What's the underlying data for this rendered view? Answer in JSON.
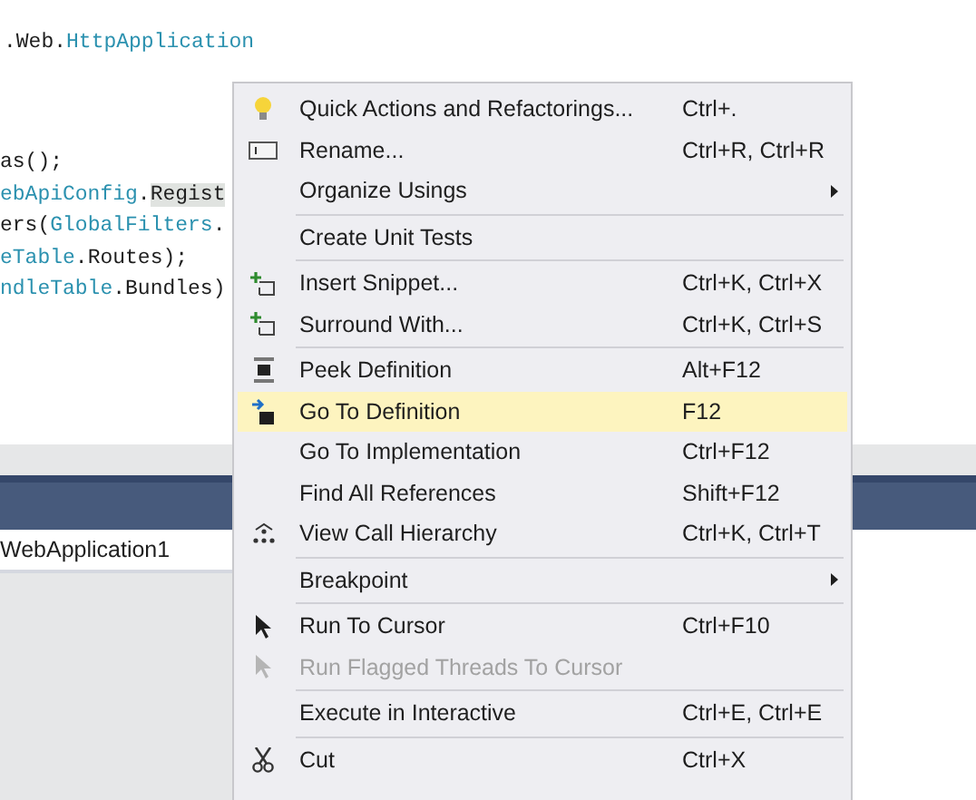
{
  "editor": {
    "lines": [
      [
        {
          "text": ".Web.",
          "kind": "plain"
        },
        {
          "text": "HttpApplication",
          "kind": "type"
        }
      ],
      [
        {
          "text": "as();",
          "kind": "plain"
        }
      ],
      [
        {
          "text": "ebApiConfig",
          "kind": "type"
        },
        {
          "text": ".",
          "kind": "plain"
        },
        {
          "text": "Regist",
          "kind": "highlight"
        }
      ],
      [
        {
          "text": "ers(",
          "kind": "plain"
        },
        {
          "text": "GlobalFilters",
          "kind": "type"
        },
        {
          "text": ".",
          "kind": "plain"
        }
      ],
      [
        {
          "text": "eTable",
          "kind": "type"
        },
        {
          "text": ".Routes);",
          "kind": "plain"
        }
      ],
      [
        {
          "text": "ndleTable",
          "kind": "type"
        },
        {
          "text": ".Bundles)",
          "kind": "plain"
        }
      ]
    ]
  },
  "panel": {
    "field_value": "WebApplication1"
  },
  "context_menu": {
    "items": [
      {
        "kind": "item",
        "label": "Quick Actions and Refactorings...",
        "shortcut": "Ctrl+.",
        "submenu": false,
        "disabled": false,
        "selected": false
      },
      {
        "kind": "item",
        "label": "Rename...",
        "shortcut": "Ctrl+R, Ctrl+R",
        "submenu": false,
        "disabled": false,
        "selected": false
      },
      {
        "kind": "item",
        "label": "Organize Usings",
        "submenu": true,
        "disabled": false,
        "selected": false
      },
      {
        "kind": "separator"
      },
      {
        "kind": "item",
        "label": "Create Unit Tests",
        "submenu": false,
        "disabled": false,
        "selected": false
      },
      {
        "kind": "separator"
      },
      {
        "kind": "item",
        "label": "Insert Snippet...",
        "shortcut": "Ctrl+K, Ctrl+X",
        "submenu": false,
        "disabled": false,
        "selected": false
      },
      {
        "kind": "item",
        "label": "Surround With...",
        "shortcut": "Ctrl+K, Ctrl+S",
        "submenu": false,
        "disabled": false,
        "selected": false
      },
      {
        "kind": "separator"
      },
      {
        "kind": "item",
        "label": "Peek Definition",
        "shortcut": "Alt+F12",
        "submenu": false,
        "disabled": false,
        "selected": false
      },
      {
        "kind": "item",
        "label": "Go To Definition",
        "shortcut": "F12",
        "submenu": false,
        "disabled": false,
        "selected": true
      },
      {
        "kind": "item",
        "label": "Go To Implementation",
        "shortcut": "Ctrl+F12",
        "submenu": false,
        "disabled": false,
        "selected": false
      },
      {
        "kind": "item",
        "label": "Find All References",
        "shortcut": "Shift+F12",
        "submenu": false,
        "disabled": false,
        "selected": false
      },
      {
        "kind": "item",
        "label": "View Call Hierarchy",
        "shortcut": "Ctrl+K, Ctrl+T",
        "submenu": false,
        "disabled": false,
        "selected": false
      },
      {
        "kind": "separator"
      },
      {
        "kind": "item",
        "label": "Breakpoint",
        "submenu": true,
        "disabled": false,
        "selected": false
      },
      {
        "kind": "separator"
      },
      {
        "kind": "item",
        "label": "Run To Cursor",
        "shortcut": "Ctrl+F10",
        "submenu": false,
        "disabled": false,
        "selected": false
      },
      {
        "kind": "item",
        "label": "Run Flagged Threads To Cursor",
        "submenu": false,
        "disabled": true,
        "selected": false
      },
      {
        "kind": "separator"
      },
      {
        "kind": "item",
        "label": "Execute in Interactive",
        "shortcut": "Ctrl+E, Ctrl+E",
        "submenu": false,
        "disabled": false,
        "selected": false
      },
      {
        "kind": "separator"
      },
      {
        "kind": "item",
        "label": "Cut",
        "shortcut": "Ctrl+X",
        "submenu": false,
        "disabled": false,
        "selected": false
      }
    ]
  }
}
